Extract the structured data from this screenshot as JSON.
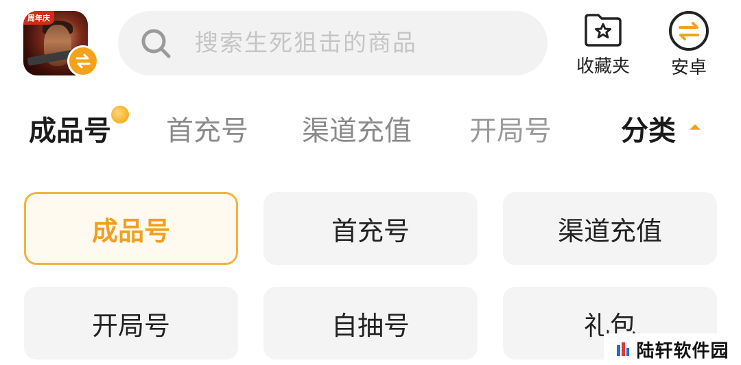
{
  "header": {
    "game_banner": "周年庆",
    "search_placeholder": "搜索生死狙击的商品",
    "favorites_label": "收藏夹",
    "platform_label": "安卓"
  },
  "tabs": [
    {
      "label": "成品号"
    },
    {
      "label": "首充号"
    },
    {
      "label": "渠道充值"
    },
    {
      "label": "开局号"
    }
  ],
  "category_label": "分类",
  "grid": [
    {
      "label": "成品号"
    },
    {
      "label": "首充号"
    },
    {
      "label": "渠道充值"
    },
    {
      "label": "开局号"
    },
    {
      "label": "自抽号"
    },
    {
      "label": "礼包"
    }
  ],
  "watermark": "陆轩软件园",
  "colors": {
    "accent": "#f4a21b",
    "active_border": "#f3b23f",
    "active_text": "#f0a020"
  }
}
